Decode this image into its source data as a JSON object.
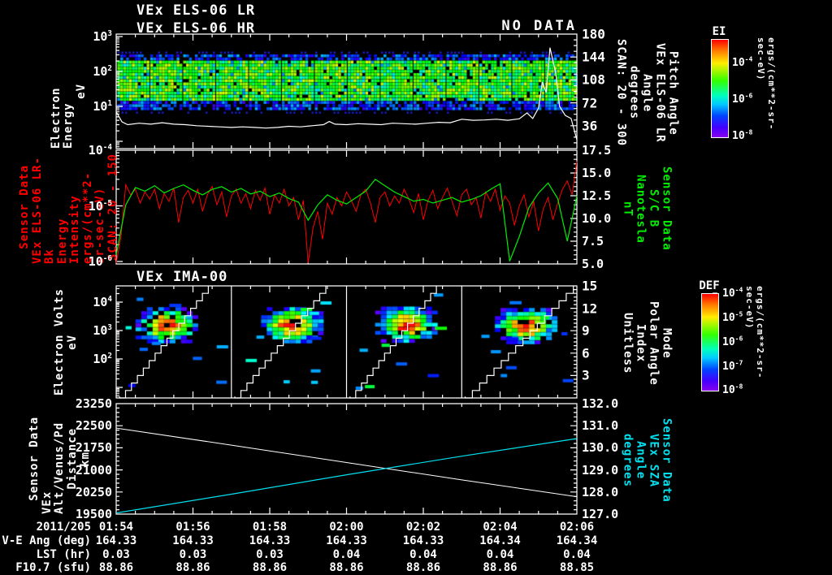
{
  "colors": {
    "background": "#000000",
    "axis": "#ffffff",
    "red": "#ff0000",
    "green": "#00ee00",
    "cyan": "#00e0ee",
    "white": "#ffffff"
  },
  "titles": {
    "panel1_line1": "VEx ELS-06 LR",
    "panel1_line2": "VEx ELS-06 HR",
    "no_data": "NO DATA",
    "panel3": "VEx IMA-00"
  },
  "x_axis": {
    "date": "2011/205",
    "tick_labels": [
      "01:54",
      "01:56",
      "01:58",
      "02:00",
      "02:02",
      "02:04",
      "02:06"
    ],
    "minutes_span": 12
  },
  "chart_data": [
    {
      "id": "panel1",
      "type": "heatmap",
      "title": "VEx ELS-06 LR / VEx ELS-06 HR",
      "annotation": "NO DATA",
      "y_left": {
        "label_lines": [
          "Electron Energy",
          "eV"
        ],
        "scale": "log",
        "tick_exponents": [
          3,
          2,
          1
        ]
      },
      "y_right": {
        "label_lines": [
          "Pitch Angle",
          "VEx ELS-06 LR",
          "Angle",
          "degrees",
          "SCAN: 20 - 300"
        ],
        "ticks": [
          180,
          144,
          108,
          72,
          36
        ],
        "range": [
          0,
          180
        ]
      },
      "spectrogram": {
        "segments": 14,
        "energy_band_ev": [
          8,
          290
        ],
        "palette": "rainbow",
        "dominant": "cyan-green speckle with blue edges"
      },
      "white_line_ev": [
        [
          0,
          7
        ],
        [
          0.15,
          3.6
        ],
        [
          0.3,
          3.0
        ],
        [
          0.6,
          3.3
        ],
        [
          0.9,
          3.1
        ],
        [
          1.2,
          3.4
        ],
        [
          1.5,
          3.1
        ],
        [
          1.8,
          3.0
        ],
        [
          2.1,
          2.8
        ],
        [
          2.4,
          2.7
        ],
        [
          2.7,
          2.6
        ],
        [
          3.0,
          2.5
        ],
        [
          3.3,
          2.6
        ],
        [
          3.6,
          2.5
        ],
        [
          3.9,
          2.4
        ],
        [
          4.2,
          2.5
        ],
        [
          4.5,
          2.7
        ],
        [
          4.8,
          2.6
        ],
        [
          5.1,
          2.8
        ],
        [
          5.4,
          3.0
        ],
        [
          5.55,
          3.7
        ],
        [
          5.7,
          3.1
        ],
        [
          6.0,
          3.0
        ],
        [
          6.3,
          3.2
        ],
        [
          6.6,
          3.1
        ],
        [
          6.9,
          3.0
        ],
        [
          7.2,
          3.3
        ],
        [
          7.5,
          3.2
        ],
        [
          7.8,
          3.1
        ],
        [
          8.1,
          3.3
        ],
        [
          8.4,
          3.5
        ],
        [
          8.7,
          3.4
        ],
        [
          9.0,
          4.3
        ],
        [
          9.3,
          4.0
        ],
        [
          9.6,
          4.1
        ],
        [
          9.9,
          4.3
        ],
        [
          10.2,
          4.0
        ],
        [
          10.5,
          4.4
        ],
        [
          10.7,
          6.5
        ],
        [
          10.85,
          4.5
        ],
        [
          11.0,
          9
        ],
        [
          11.1,
          50
        ],
        [
          11.2,
          25
        ],
        [
          11.3,
          480
        ],
        [
          11.45,
          90
        ],
        [
          11.55,
          10
        ],
        [
          11.7,
          5.5
        ],
        [
          11.85,
          4.5
        ],
        [
          12,
          1.1
        ]
      ]
    },
    {
      "id": "panel2",
      "type": "line",
      "y_left": {
        "label_lines": [
          "Sensor Data",
          "VEx ELS-06 LR-Bk",
          "Energy Intensity",
          "ergs/(cm**2-sr-sec-eV)",
          "SCAN: 20 - 150"
        ],
        "scale": "log",
        "tick_exponents": [
          -4,
          -5,
          -6
        ],
        "color": "#ff0000"
      },
      "y_right": {
        "label_lines": [
          "Sensor Data",
          "S/C B",
          "Nanotesla",
          "nT"
        ],
        "ticks": [
          17.5,
          15.0,
          12.5,
          10.0,
          7.5,
          5.0
        ],
        "range": [
          5.0,
          17.5
        ],
        "color": "#00ee00"
      },
      "series": [
        {
          "name": "energy-intensity",
          "color": "#ff0000",
          "axis": "left",
          "dt_min": 0.125,
          "log10_values": [
            -6.1,
            -5.55,
            -4.62,
            -4.8,
            -4.7,
            -4.95,
            -4.75,
            -4.88,
            -4.7,
            -5.05,
            -4.78,
            -4.92,
            -4.68,
            -5.3,
            -4.85,
            -4.72,
            -4.95,
            -4.7,
            -5.1,
            -4.8,
            -4.65,
            -4.98,
            -4.75,
            -5.2,
            -4.82,
            -4.7,
            -4.95,
            -4.78,
            -5.05,
            -4.72,
            -4.9,
            -4.68,
            -5.15,
            -4.8,
            -4.95,
            -4.7,
            -5.0,
            -4.85,
            -5.25,
            -4.9,
            -6.05,
            -5.4,
            -5.1,
            -5.6,
            -4.95,
            -5.15,
            -4.85,
            -5.0,
            -4.75,
            -4.9,
            -5.1,
            -4.8,
            -4.7,
            -4.95,
            -5.3,
            -4.85,
            -4.75,
            -5.0,
            -4.82,
            -4.95,
            -4.7,
            -4.88,
            -5.12,
            -4.78,
            -5.25,
            -4.9,
            -4.72,
            -5.05,
            -4.85,
            -4.68,
            -4.92,
            -5.18,
            -4.8,
            -4.7,
            -4.98,
            -4.85,
            -5.22,
            -4.75,
            -4.92,
            -4.7,
            -5.08,
            -4.82,
            -4.95,
            -5.35,
            -5.0,
            -4.8,
            -5.2,
            -4.92,
            -5.45,
            -5.05,
            -4.85,
            -5.25,
            -4.95,
            -4.7,
            -4.55,
            -4.8,
            -4.2
          ]
        },
        {
          "name": "sc-b-field",
          "color": "#00ee00",
          "axis": "right",
          "dt_min": 0.25,
          "values_nT": [
            6.0,
            11.5,
            13.4,
            13.0,
            13.6,
            12.8,
            13.3,
            13.7,
            13.1,
            12.6,
            13.2,
            13.5,
            12.9,
            13.3,
            12.7,
            13.0,
            12.4,
            12.8,
            12.2,
            11.8,
            9.8,
            11.5,
            12.6,
            12.0,
            11.6,
            12.3,
            13.0,
            14.3,
            13.6,
            12.9,
            12.4,
            11.9,
            12.1,
            11.7,
            12.0,
            12.3,
            11.8,
            12.1,
            12.5,
            13.2,
            13.8,
            5.3,
            8.0,
            11.2,
            12.8,
            13.9,
            12.2,
            7.5,
            12.5
          ]
        }
      ]
    },
    {
      "id": "panel3",
      "type": "heatmap",
      "title": "VEx IMA-00",
      "y_left": {
        "label_lines": [
          "Electron Volts",
          "eV"
        ],
        "scale": "log",
        "tick_exponents": [
          4,
          3,
          2
        ]
      },
      "y_right": {
        "label_lines": [
          "Mode",
          "Polar Angle",
          "Index",
          "Unitless"
        ],
        "ticks": [
          15,
          12,
          9,
          6,
          3
        ],
        "range": [
          0,
          15
        ]
      },
      "subpanels": 4,
      "clusters": [
        {
          "x_frac": 0.44,
          "log10_ev": 3.18
        },
        {
          "x_frac": 0.53,
          "log10_ev": 3.18
        },
        {
          "x_frac": 0.52,
          "log10_ev": 3.2
        },
        {
          "x_frac": 0.56,
          "log10_ev": 3.15
        }
      ],
      "staircase": {
        "steps": 15,
        "x_start_frac": 0.03,
        "x_end_frac": [
          0.8,
          0.82,
          0.78,
          0.97
        ],
        "index_range": [
          0,
          15
        ]
      }
    },
    {
      "id": "panel4",
      "type": "line",
      "y_left": {
        "label_lines": [
          "Sensor Data",
          "VEx Alt/Venus/Pd",
          "Distance",
          "km"
        ],
        "ticks": [
          23250,
          22500,
          21750,
          21000,
          20250,
          19500
        ],
        "range": [
          19500,
          23250
        ],
        "color": "#ffffff"
      },
      "y_right": {
        "label_lines": [
          "Sensor Data",
          "VEx SZA",
          "Angle",
          "degrees"
        ],
        "ticks": [
          132.0,
          131.0,
          130.0,
          129.0,
          128.0,
          127.0
        ],
        "range": [
          127.0,
          132.0
        ],
        "color": "#00e0ee"
      },
      "series": [
        {
          "name": "distance-km",
          "color": "#ffffff",
          "axis": "left",
          "points": [
            [
              0,
              22420
            ],
            [
              3,
              21840
            ],
            [
              6,
              21250
            ],
            [
              9,
              20660
            ],
            [
              12,
              20090
            ]
          ]
        },
        {
          "name": "sza-deg",
          "color": "#00e0ee",
          "axis": "right",
          "points": [
            [
              0,
              127.05
            ],
            [
              3,
              127.9
            ],
            [
              6,
              128.78
            ],
            [
              9,
              129.62
            ],
            [
              12,
              130.42
            ]
          ]
        }
      ]
    }
  ],
  "colorbars": [
    {
      "title": "EI",
      "tick_exponents": [
        -4,
        -6,
        -8
      ],
      "unit": "ergs/(cm**2-sr-sec-eV)"
    },
    {
      "title": "DEF",
      "tick_exponents": [
        -4,
        -5,
        -6,
        -7,
        -8
      ],
      "unit": "ergs/(cm**2-sr-sec-eV)"
    }
  ],
  "table": {
    "date": "2011/205",
    "times": [
      "01:54",
      "01:56",
      "01:58",
      "02:00",
      "02:02",
      "02:04",
      "02:06"
    ],
    "rows": [
      {
        "label": "V-E Ang (deg)",
        "values": [
          "164.33",
          "164.33",
          "164.33",
          "164.33",
          "164.33",
          "164.34",
          "164.34"
        ]
      },
      {
        "label": "LST (hr)",
        "values": [
          "0.03",
          "0.03",
          "0.03",
          "0.04",
          "0.04",
          "0.04",
          "0.04"
        ]
      },
      {
        "label": "F10.7 (sfu)",
        "values": [
          "88.86",
          "88.86",
          "88.86",
          "88.86",
          "88.86",
          "88.86",
          "88.85"
        ]
      }
    ]
  },
  "render_seed": 1337
}
